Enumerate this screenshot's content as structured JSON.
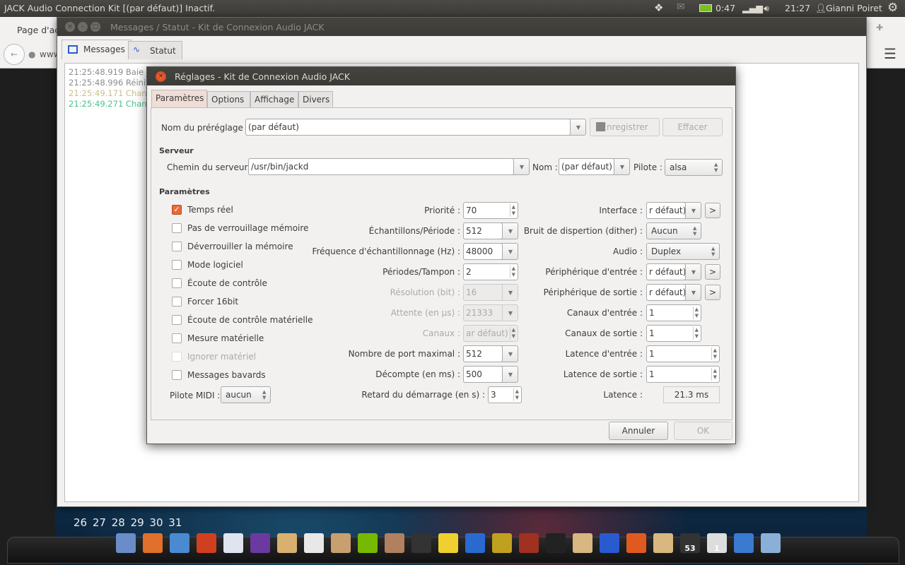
{
  "panel": {
    "title": "JACK Audio Connection Kit [(par défaut)] Inactif.",
    "battery": "0:47",
    "clock": "21:27",
    "user": "Gianni Poiret",
    "icons": [
      "dropbox-icon",
      "mail-icon",
      "battery-icon",
      "signal-icon",
      "volume-icon",
      "user-icon",
      "gear-icon"
    ]
  },
  "browser": {
    "tab": "Page d'acc",
    "url": "www"
  },
  "desktop": {
    "calendar": "26 27 28 29 30 31"
  },
  "messages_window": {
    "title": "Messages / Statut - Kit de Connexion Audio JACK",
    "tabs": [
      "Messages",
      "Statut"
    ],
    "log": [
      {
        "time": "21:25:48.919",
        "text": "Baie de",
        "color": "#8c8c8c"
      },
      {
        "time": "21:25:48.996",
        "text": "Réiniti",
        "color": "#8c8c8c"
      },
      {
        "time": "21:25:49.171",
        "text": "Change",
        "color": "#c8c08a"
      },
      {
        "time": "21:25:49.271",
        "text": "Change",
        "color": "#4cc08a"
      }
    ]
  },
  "dialog": {
    "title": "Réglages - Kit de Connexion Audio JACK",
    "tabs": [
      "Paramètres",
      "Options",
      "Affichage",
      "Divers"
    ],
    "preset_label": "Nom du préréglage :",
    "preset_value": "(par défaut)",
    "save": "Enregistrer",
    "delete": "Effacer",
    "server_heading": "Serveur",
    "server_path_label": "Chemin du serveur :",
    "server_path": "/usr/bin/jackd",
    "name_label": "Nom :",
    "name_value": "(par défaut)",
    "driver_label": "Pilote :",
    "driver_value": "alsa",
    "params_heading": "Paramètres",
    "checkboxes": [
      {
        "label": "Temps réel",
        "checked": true
      },
      {
        "label": "Pas de verrouillage mémoire",
        "checked": false
      },
      {
        "label": "Déverrouiller la mémoire",
        "checked": false
      },
      {
        "label": "Mode logiciel",
        "checked": false
      },
      {
        "label": "Écoute de contrôle",
        "checked": false
      },
      {
        "label": "Forcer 16bit",
        "checked": false
      },
      {
        "label": "Écoute de contrôle matérielle",
        "checked": false
      },
      {
        "label": "Mesure matérielle",
        "checked": false
      },
      {
        "label": "Ignorer matériel",
        "checked": false,
        "disabled": true
      },
      {
        "label": "Messages bavards",
        "checked": false
      }
    ],
    "midi_label": "Pilote MIDI :",
    "midi_value": "aucun",
    "middle": [
      {
        "label": "Priorité :",
        "value": "70",
        "kind": "spin"
      },
      {
        "label": "Échantillons/Période :",
        "value": "512",
        "kind": "combo"
      },
      {
        "label": "Fréquence d'échantillonnage (Hz) :",
        "value": "48000",
        "kind": "combo"
      },
      {
        "label": "Périodes/Tampon :",
        "value": "2",
        "kind": "spin"
      },
      {
        "label": "Résolution (bit) :",
        "value": "16",
        "kind": "combo",
        "disabled": true
      },
      {
        "label": "Attente (en µs) :",
        "value": "21333",
        "kind": "combo",
        "disabled": true
      },
      {
        "label": "Canaux :",
        "value": "ar défaut)",
        "kind": "spin",
        "disabled": true
      },
      {
        "label": "Nombre de port maximal :",
        "value": "512",
        "kind": "combo"
      },
      {
        "label": "Décompte (en ms) :",
        "value": "500",
        "kind": "combo"
      },
      {
        "label": "Retard du démarrage (en s) :",
        "value": "3",
        "kind": "spin"
      }
    ],
    "right": [
      {
        "label": "Interface :",
        "value": "r défaut)",
        "kind": "combo-more"
      },
      {
        "label": "Bruit de dispertion (dither) :",
        "value": "Aucun",
        "kind": "select"
      },
      {
        "label": "Audio :",
        "value": "Duplex",
        "kind": "select-wide"
      },
      {
        "label": "Périphérique d'entrée :",
        "value": "r défaut)",
        "kind": "combo-more"
      },
      {
        "label": "Périphérique de sortie :",
        "value": "r défaut)",
        "kind": "combo-more"
      },
      {
        "label": "Canaux d'entrée :",
        "value": "1",
        "kind": "spin"
      },
      {
        "label": "Canaux de sortie :",
        "value": "1",
        "kind": "spin"
      },
      {
        "label": "Latence d'entrée :",
        "value": "1",
        "kind": "spin-wide"
      },
      {
        "label": "Latence de sortie :",
        "value": "1",
        "kind": "spin-wide"
      },
      {
        "label": "Latence :",
        "value": "21.3 ms",
        "kind": "readout"
      }
    ],
    "more_label": ">",
    "cancel": "Annuler",
    "ok": "OK"
  },
  "dock": {
    "items": [
      {
        "name": "workspaces",
        "color": "#6a8cc8"
      },
      {
        "name": "firefox",
        "color": "#e0702a"
      },
      {
        "name": "pen-editor",
        "color": "#4a8ad0"
      },
      {
        "name": "disc-burner",
        "color": "#d04020"
      },
      {
        "name": "hydrogen",
        "color": "#dfe4ee"
      },
      {
        "name": "headphones",
        "color": "#6a3aa0"
      },
      {
        "name": "paint",
        "color": "#d8b070"
      },
      {
        "name": "document",
        "color": "#e8e8e8"
      },
      {
        "name": "package",
        "color": "#c8a070"
      },
      {
        "name": "nvidia",
        "color": "#76b900"
      },
      {
        "name": "chess",
        "color": "#b08060"
      },
      {
        "name": "tux",
        "color": "#333333"
      },
      {
        "name": "dropbox",
        "color": "#f0d030"
      },
      {
        "name": "sl-app",
        "color": "#2a6ad0"
      },
      {
        "name": "pen-tool",
        "color": "#c0a020"
      },
      {
        "name": "guitar",
        "color": "#a03020"
      },
      {
        "name": "add",
        "color": "#222222"
      },
      {
        "name": "folder",
        "color": "#d8b880"
      },
      {
        "name": "jack-control",
        "color": "#2a5ad0"
      },
      {
        "name": "ubuntu",
        "color": "#e05a20"
      },
      {
        "name": "folder-2",
        "color": "#d8b880"
      },
      {
        "name": "gauge",
        "color": "#333333",
        "badge": "53"
      },
      {
        "name": "power",
        "color": "#dddddd",
        "badge": "1"
      },
      {
        "name": "text-editor",
        "color": "#3a7ad0"
      },
      {
        "name": "trash",
        "color": "#8ab0d8"
      }
    ]
  }
}
